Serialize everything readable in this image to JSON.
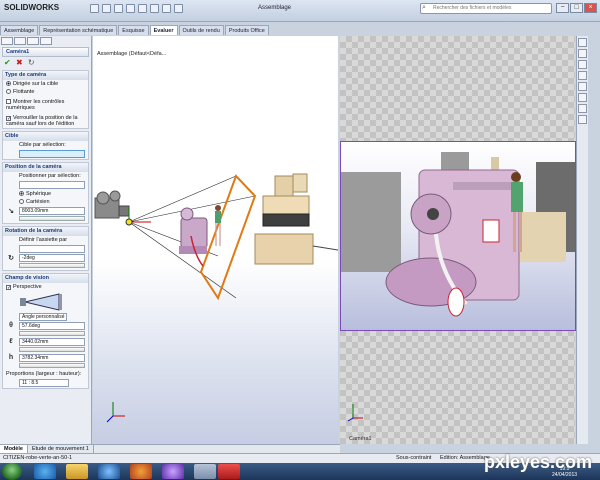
{
  "app": {
    "logo_text_a": "SOLID",
    "logo_text_b": "WORKS",
    "title": "Assemblage",
    "search_placeholder": "Rechercher des fichiers et modèles",
    "win_min": "−",
    "win_max": "□",
    "win_close": "×"
  },
  "tabs": [
    "Assemblage",
    "Représentation schématique",
    "Esquisse",
    "Evaluer",
    "Outils de rendu",
    "Produits Office"
  ],
  "active_tab_index": 3,
  "panel": {
    "title": "Caméra1",
    "ok_icon": "✔",
    "cancel_icon": "✖",
    "pin_icon": "↻",
    "sections": {
      "type": {
        "header": "Type de caméra",
        "opt1": "Dirigée sur la cible",
        "opt2": "Flottante",
        "chk1": "Montrer les contrôles numériques",
        "chk2": "Verrouiller la position de la caméra sauf lors de l'édition"
      },
      "cible": {
        "header": "Cible",
        "label": "Cible par sélection:"
      },
      "position": {
        "header": "Position de la caméra",
        "label": "Positionner par sélection:",
        "opt1": "Sphérique",
        "opt2": "Cartésien",
        "value": "8003.09mm"
      },
      "rotation": {
        "header": "Rotation de la caméra",
        "label": "Définir l'assiette par",
        "value": "-2deg"
      },
      "champ": {
        "header": "Champ de vision",
        "chk": "Perspective",
        "dropdown": "Angle personnalisé",
        "theta": "57.6deg",
        "ell": "3440.02mm",
        "h": "3782.34mm",
        "prop_label": "Proportions (largeur : hauteur):",
        "prop_value": "11 : 8.5"
      }
    }
  },
  "tree": {
    "label": "Assemblage (Défaut<Défa..."
  },
  "viewport": {
    "camera_label": "Caméra1"
  },
  "bottom_tabs": [
    "Modèle",
    "Etude de mouvement 1"
  ],
  "status": {
    "file": "CITIZEN-robe-verte-an-50-1",
    "state": "Sous-contraint",
    "mode": "Edition: Assemblage"
  },
  "clock": {
    "time": "19:5",
    "date": "24/04/2013"
  },
  "watermark": "pxleyes.com"
}
